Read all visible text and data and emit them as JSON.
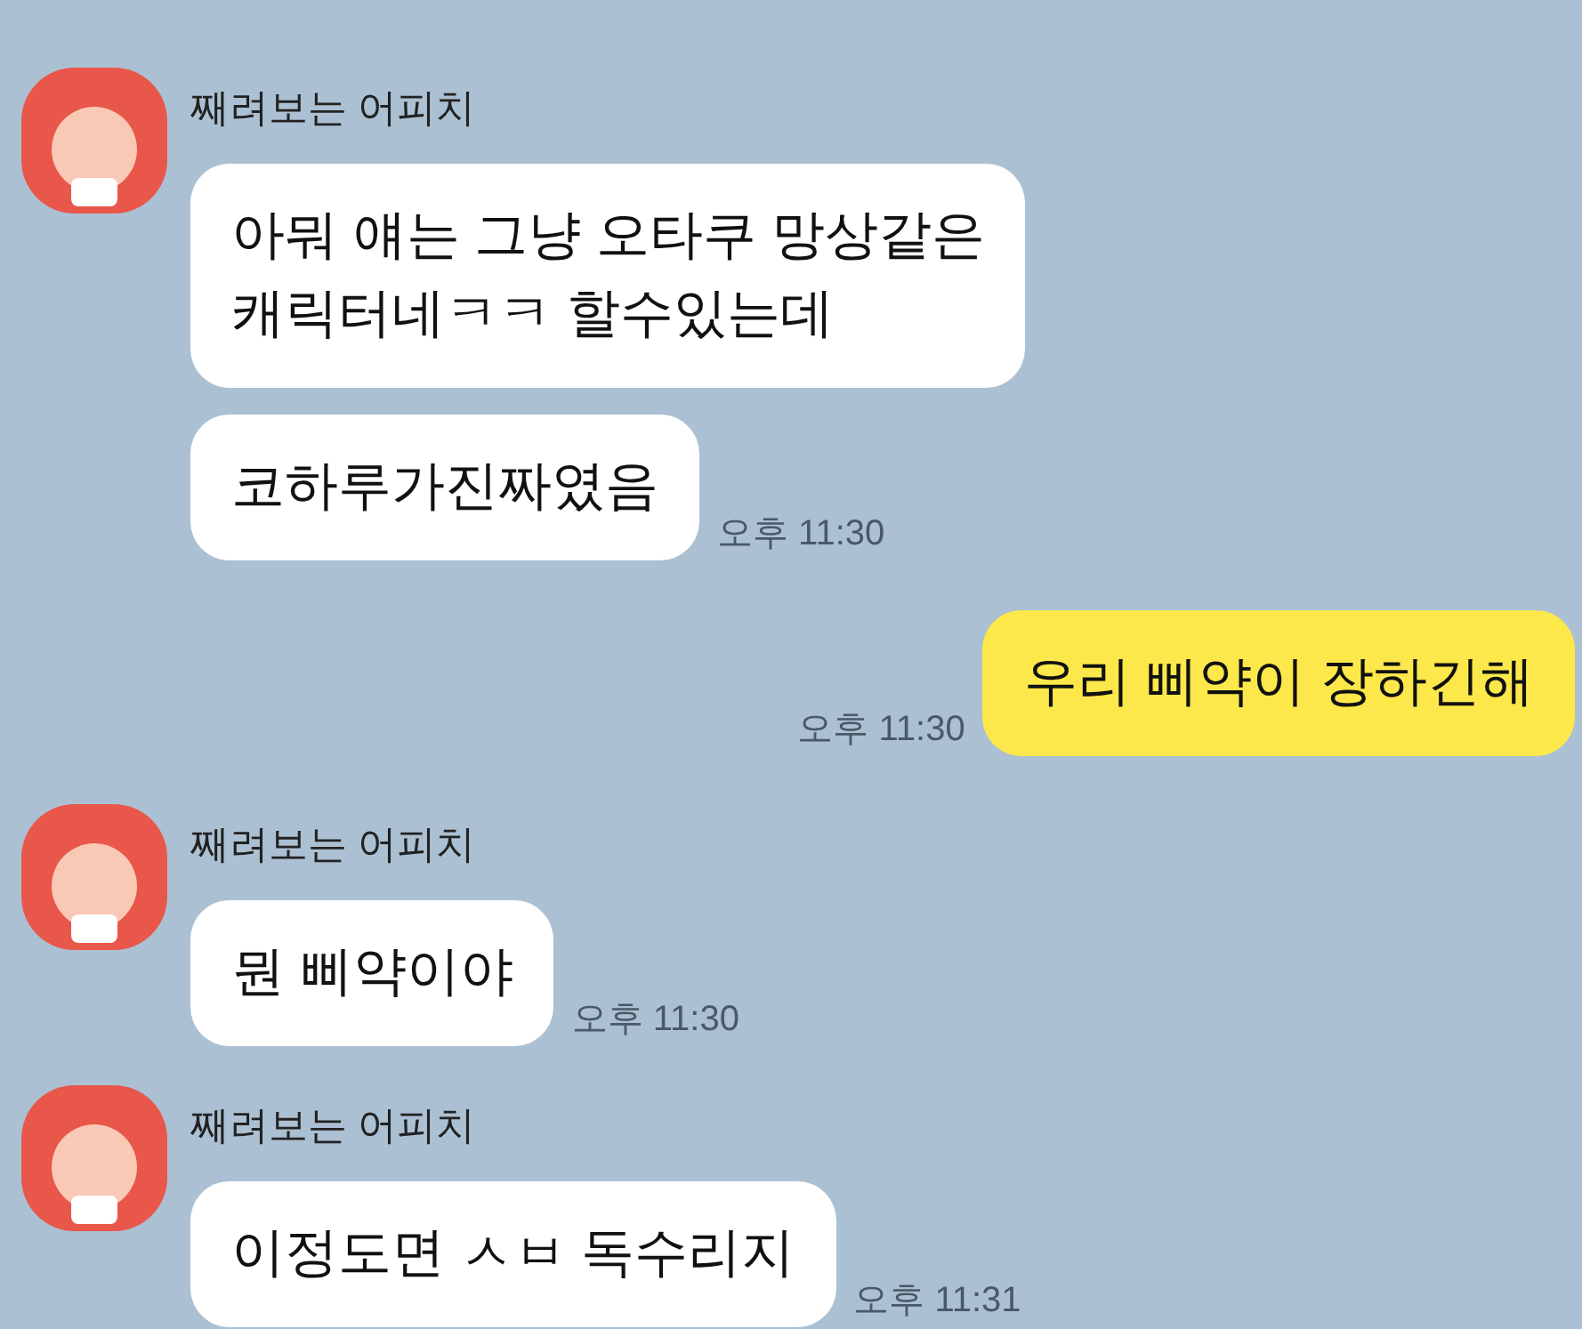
{
  "messages": [
    {
      "kind": "incoming",
      "sender": "째려보는 어피치",
      "bubbles": [
        {
          "text": "아뭐 얘는 그냥 오타쿠 망상같은\n캐릭터네ㅋㅋ 할수있는데"
        },
        {
          "text": "코하루가진짜였음",
          "time": "오후 11:30"
        }
      ]
    },
    {
      "kind": "outgoing",
      "bubbles": [
        {
          "text": "우리 삐약이 장하긴해",
          "time": "오후 11:30"
        }
      ]
    },
    {
      "kind": "incoming",
      "sender": "째려보는 어피치",
      "bubbles": [
        {
          "text": "뭔 삐약이야",
          "time": "오후 11:30"
        }
      ]
    },
    {
      "kind": "incoming",
      "sender": "째려보는 어피치",
      "bubbles": [
        {
          "text": "이정도면 ㅅㅂ 독수리지",
          "time": "오후 11:31"
        }
      ]
    }
  ]
}
